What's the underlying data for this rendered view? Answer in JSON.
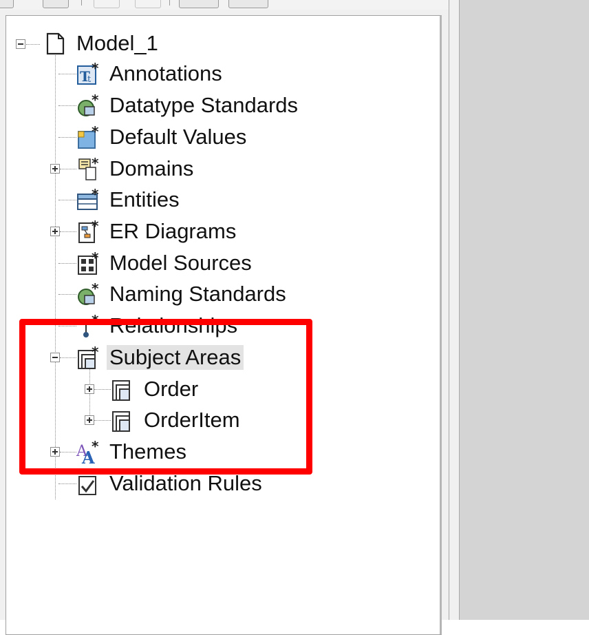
{
  "tree": {
    "root": "Model_1",
    "items": [
      {
        "label": "Annotations",
        "icon": "annotations-icon"
      },
      {
        "label": "Datatype Standards",
        "icon": "datatype-standards-icon"
      },
      {
        "label": "Default Values",
        "icon": "default-values-icon"
      },
      {
        "label": "Domains",
        "icon": "domains-icon"
      },
      {
        "label": "Entities",
        "icon": "entities-icon"
      },
      {
        "label": "ER Diagrams",
        "icon": "er-diagrams-icon"
      },
      {
        "label": "Model Sources",
        "icon": "model-sources-icon"
      },
      {
        "label": "Naming Standards",
        "icon": "naming-standards-icon"
      },
      {
        "label": "Relationships",
        "icon": "relationships-icon"
      },
      {
        "label": "Subject Areas",
        "icon": "subject-areas-icon"
      },
      {
        "label": "Themes",
        "icon": "themes-icon"
      },
      {
        "label": "Validation Rules",
        "icon": "validation-rules-icon"
      }
    ],
    "subject_area_children": [
      {
        "label": "Order",
        "icon": "subject-area-icon"
      },
      {
        "label": "OrderItem",
        "icon": "subject-area-icon"
      }
    ]
  },
  "colors": {
    "highlight_border": "#ff0000",
    "selected_background": "#e3e3e3",
    "right_pane": "#d4d4d4"
  }
}
